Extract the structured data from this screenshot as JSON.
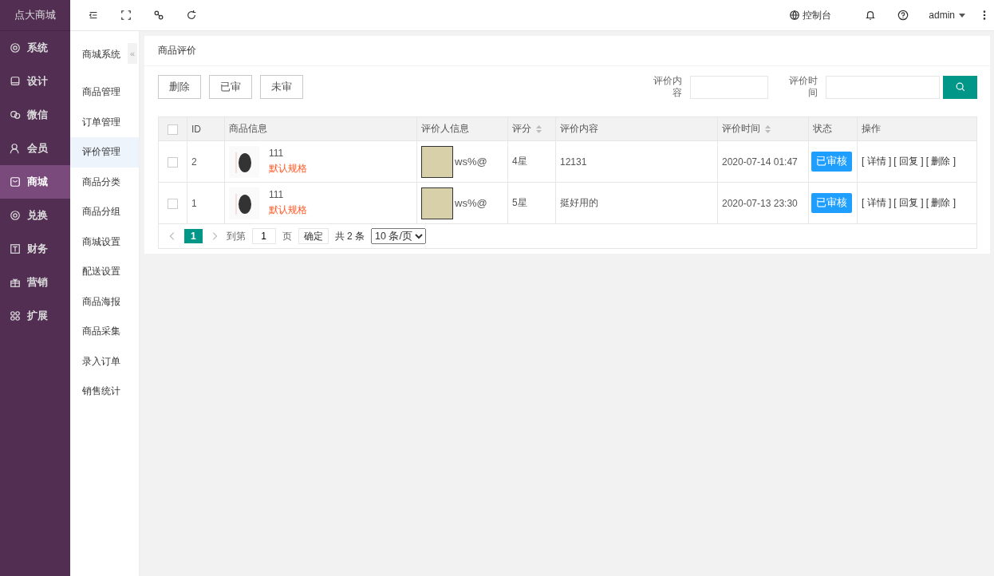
{
  "app": {
    "logo": "点大商城"
  },
  "sidebar": {
    "items": [
      {
        "label": "系统",
        "selected": false
      },
      {
        "label": "设计",
        "selected": false
      },
      {
        "label": "微信",
        "selected": false
      },
      {
        "label": "会员",
        "selected": false
      },
      {
        "label": "商城",
        "selected": true
      },
      {
        "label": "兑换",
        "selected": false
      },
      {
        "label": "财务",
        "selected": false
      },
      {
        "label": "营销",
        "selected": false
      },
      {
        "label": "扩展",
        "selected": false
      }
    ]
  },
  "topbar": {
    "console": "控制台",
    "user": "admin"
  },
  "subnav": {
    "title": "商城系统",
    "collapse": "«",
    "items": [
      {
        "label": "商品管理",
        "selected": false
      },
      {
        "label": "订单管理",
        "selected": false
      },
      {
        "label": "评价管理",
        "selected": true
      },
      {
        "label": "商品分类",
        "selected": false
      },
      {
        "label": "商品分组",
        "selected": false
      },
      {
        "label": "商城设置",
        "selected": false
      },
      {
        "label": "配送设置",
        "selected": false
      },
      {
        "label": "商品海报",
        "selected": false
      },
      {
        "label": "商品采集",
        "selected": false
      },
      {
        "label": "录入订单",
        "selected": false
      },
      {
        "label": "销售统计",
        "selected": false
      }
    ]
  },
  "card": {
    "title": "商品评价"
  },
  "toolbar": {
    "buttons": [
      "删除",
      "已审",
      "未审"
    ],
    "filters": [
      {
        "label": "评价内容"
      },
      {
        "label": "评价时间"
      }
    ]
  },
  "table": {
    "header_checked": false,
    "columns": [
      {
        "label": "ID",
        "sortable": false
      },
      {
        "label": "商品信息",
        "sortable": false
      },
      {
        "label": "评价人信息",
        "sortable": false
      },
      {
        "label": "评分",
        "sortable": true
      },
      {
        "label": "评价内容",
        "sortable": false
      },
      {
        "label": "评价时间",
        "sortable": true
      },
      {
        "label": "状态",
        "sortable": false
      },
      {
        "label": "操作",
        "sortable": false
      }
    ],
    "rows": [
      {
        "checked": false,
        "id": "2",
        "product": "111",
        "spec": "默认规格",
        "reviewer": "ws%@",
        "rating": "4星",
        "content": "12131",
        "time": "2020-07-14 01:47",
        "status": "已审核",
        "actions": [
          "[ 详情 ]",
          "[ 回复 ]",
          "[ 删除 ]"
        ]
      },
      {
        "checked": false,
        "id": "1",
        "product": "111",
        "spec": "默认规格",
        "reviewer": "ws%@",
        "rating": "5星",
        "content": "挺好用的",
        "time": "2020-07-13 23:30",
        "status": "已审核",
        "actions": [
          "[ 详情 ]",
          "[ 回复 ]",
          "[ 删除 ]"
        ]
      }
    ]
  },
  "pagination": {
    "pages": [
      {
        "label": "1",
        "selected": true
      }
    ],
    "goto_label": "到第",
    "goto_value": "1",
    "page_label": "页",
    "confirm": "确定",
    "total": "共 2 条",
    "page_size": "10 条/页"
  }
}
